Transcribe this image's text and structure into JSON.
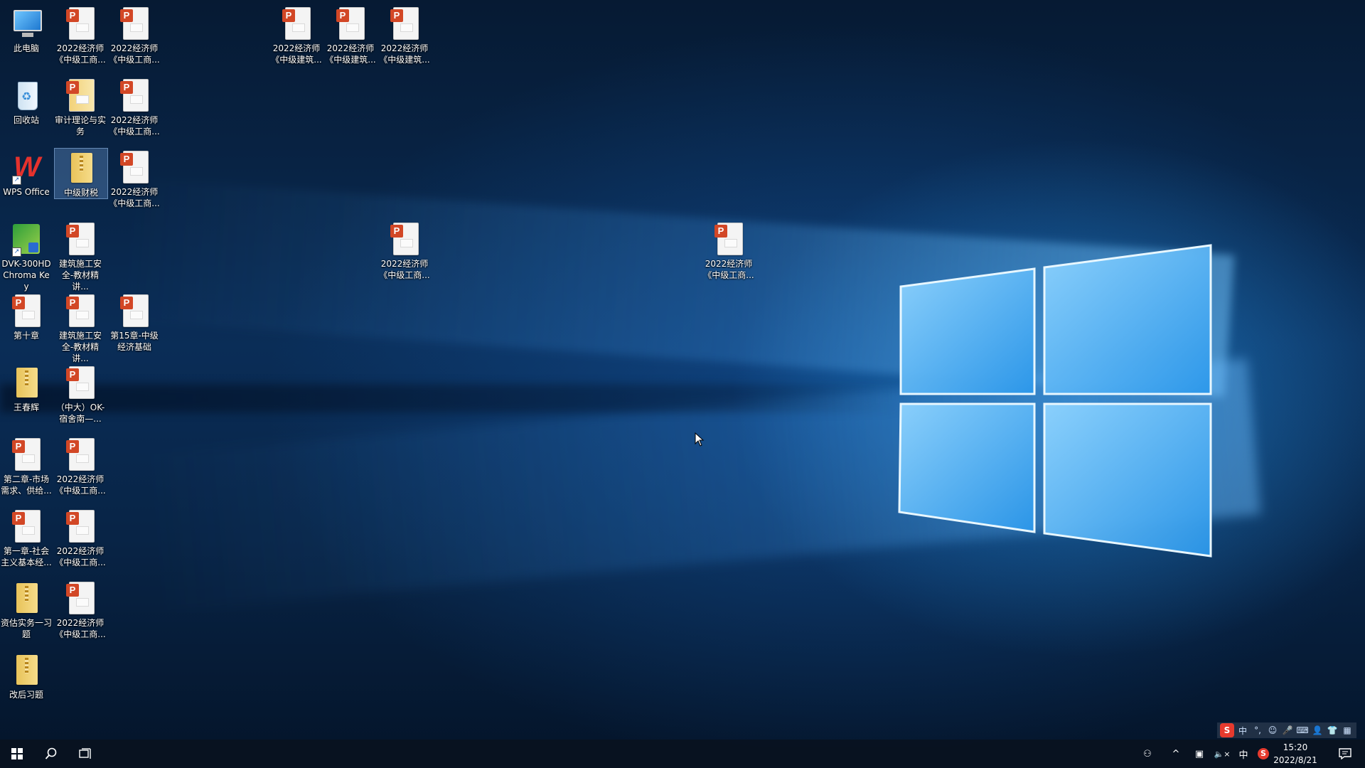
{
  "desktop": {
    "icons": [
      {
        "label": "此电脑",
        "type": "pc"
      },
      {
        "label": "2022经济师《中级工商...",
        "type": "ppt"
      },
      {
        "label": "2022经济师《中级工商...",
        "type": "ppt"
      },
      {
        "label": "2022经济师《中级建筑...",
        "type": "ppt"
      },
      {
        "label": "2022经济师《中级建筑...",
        "type": "ppt"
      },
      {
        "label": "2022经济师《中级建筑...",
        "type": "ppt"
      },
      {
        "label": "回收站",
        "type": "bin"
      },
      {
        "label": "审计理论与实务",
        "type": "ppt-yellow"
      },
      {
        "label": "2022经济师《中级工商...",
        "type": "ppt"
      },
      {
        "label": "WPS Office",
        "type": "wps"
      },
      {
        "label": "中级财税",
        "type": "zip"
      },
      {
        "label": "2022经济师《中级工商...",
        "type": "ppt"
      },
      {
        "label": "DVK-300HD Chroma Key",
        "type": "dvk"
      },
      {
        "label": "建筑施工安全-教材精讲...",
        "type": "ppt"
      },
      {
        "label": "2022经济师《中级工商...",
        "type": "ppt"
      },
      {
        "label": "2022经济师《中级工商...",
        "type": "ppt"
      },
      {
        "label": "第十章",
        "type": "ppt"
      },
      {
        "label": "建筑施工安全-教材精讲...",
        "type": "ppt"
      },
      {
        "label": "第15章-中级经济基础",
        "type": "ppt"
      },
      {
        "label": "王春辉",
        "type": "zip"
      },
      {
        "label": "（中大）OK-宿舍南—...",
        "type": "ppt"
      },
      {
        "label": "第二章-市场需求、供给...",
        "type": "ppt"
      },
      {
        "label": "2022经济师《中级工商...",
        "type": "ppt"
      },
      {
        "label": "第一章-社会主义基本经...",
        "type": "ppt"
      },
      {
        "label": "2022经济师《中级工商...",
        "type": "ppt"
      },
      {
        "label": "资估实务一习题",
        "type": "zip"
      },
      {
        "label": "2022经济师《中级工商...",
        "type": "ppt"
      },
      {
        "label": "改后习题",
        "type": "zip"
      }
    ]
  },
  "ime_toolbar": {
    "items": [
      "S",
      "中",
      "°,",
      "☺",
      "🎤",
      "⌨",
      "👤",
      "👕",
      "▦"
    ]
  },
  "taskbar": {
    "start_icon": "windows-start-icon",
    "search_icon": "search-icon",
    "taskview_icon": "task-view-icon",
    "tray": {
      "people": "⚇",
      "chevron": "^",
      "network": "▣",
      "volume": "🔈×",
      "ime": "中",
      "sogou": "S"
    },
    "time": "15:20",
    "date": "2022/8/21"
  },
  "colors": {
    "ppt_badge": "#d24726",
    "taskbar": "#081220",
    "sogou": "#e63a2e"
  }
}
